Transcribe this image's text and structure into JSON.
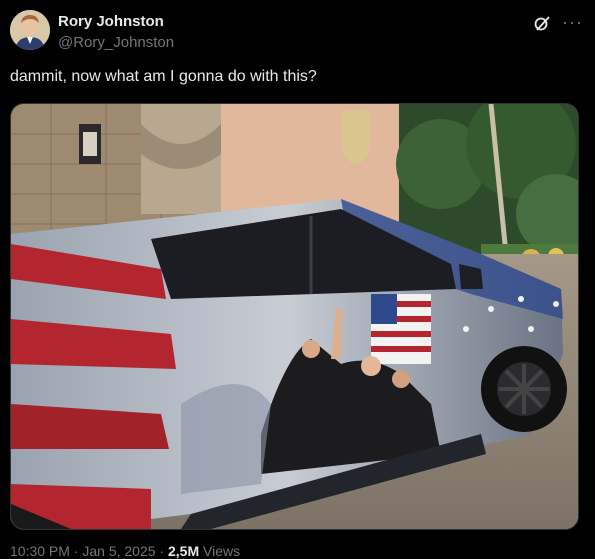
{
  "author": {
    "name": "Rory Johnston",
    "handle": "@Rory_Johnston"
  },
  "post": {
    "text": "dammit, now what am I gonna do with this?"
  },
  "footer": {
    "time": "10:30 PM · Jan 5, 2025 · ",
    "views": "2,5M",
    "views_label": " Views"
  },
  "icons": {
    "grok": "grok-icon",
    "more": "more-icon"
  },
  "colors": {
    "background": "#000000",
    "text": "#e7e9ea",
    "secondary": "#71767b"
  }
}
